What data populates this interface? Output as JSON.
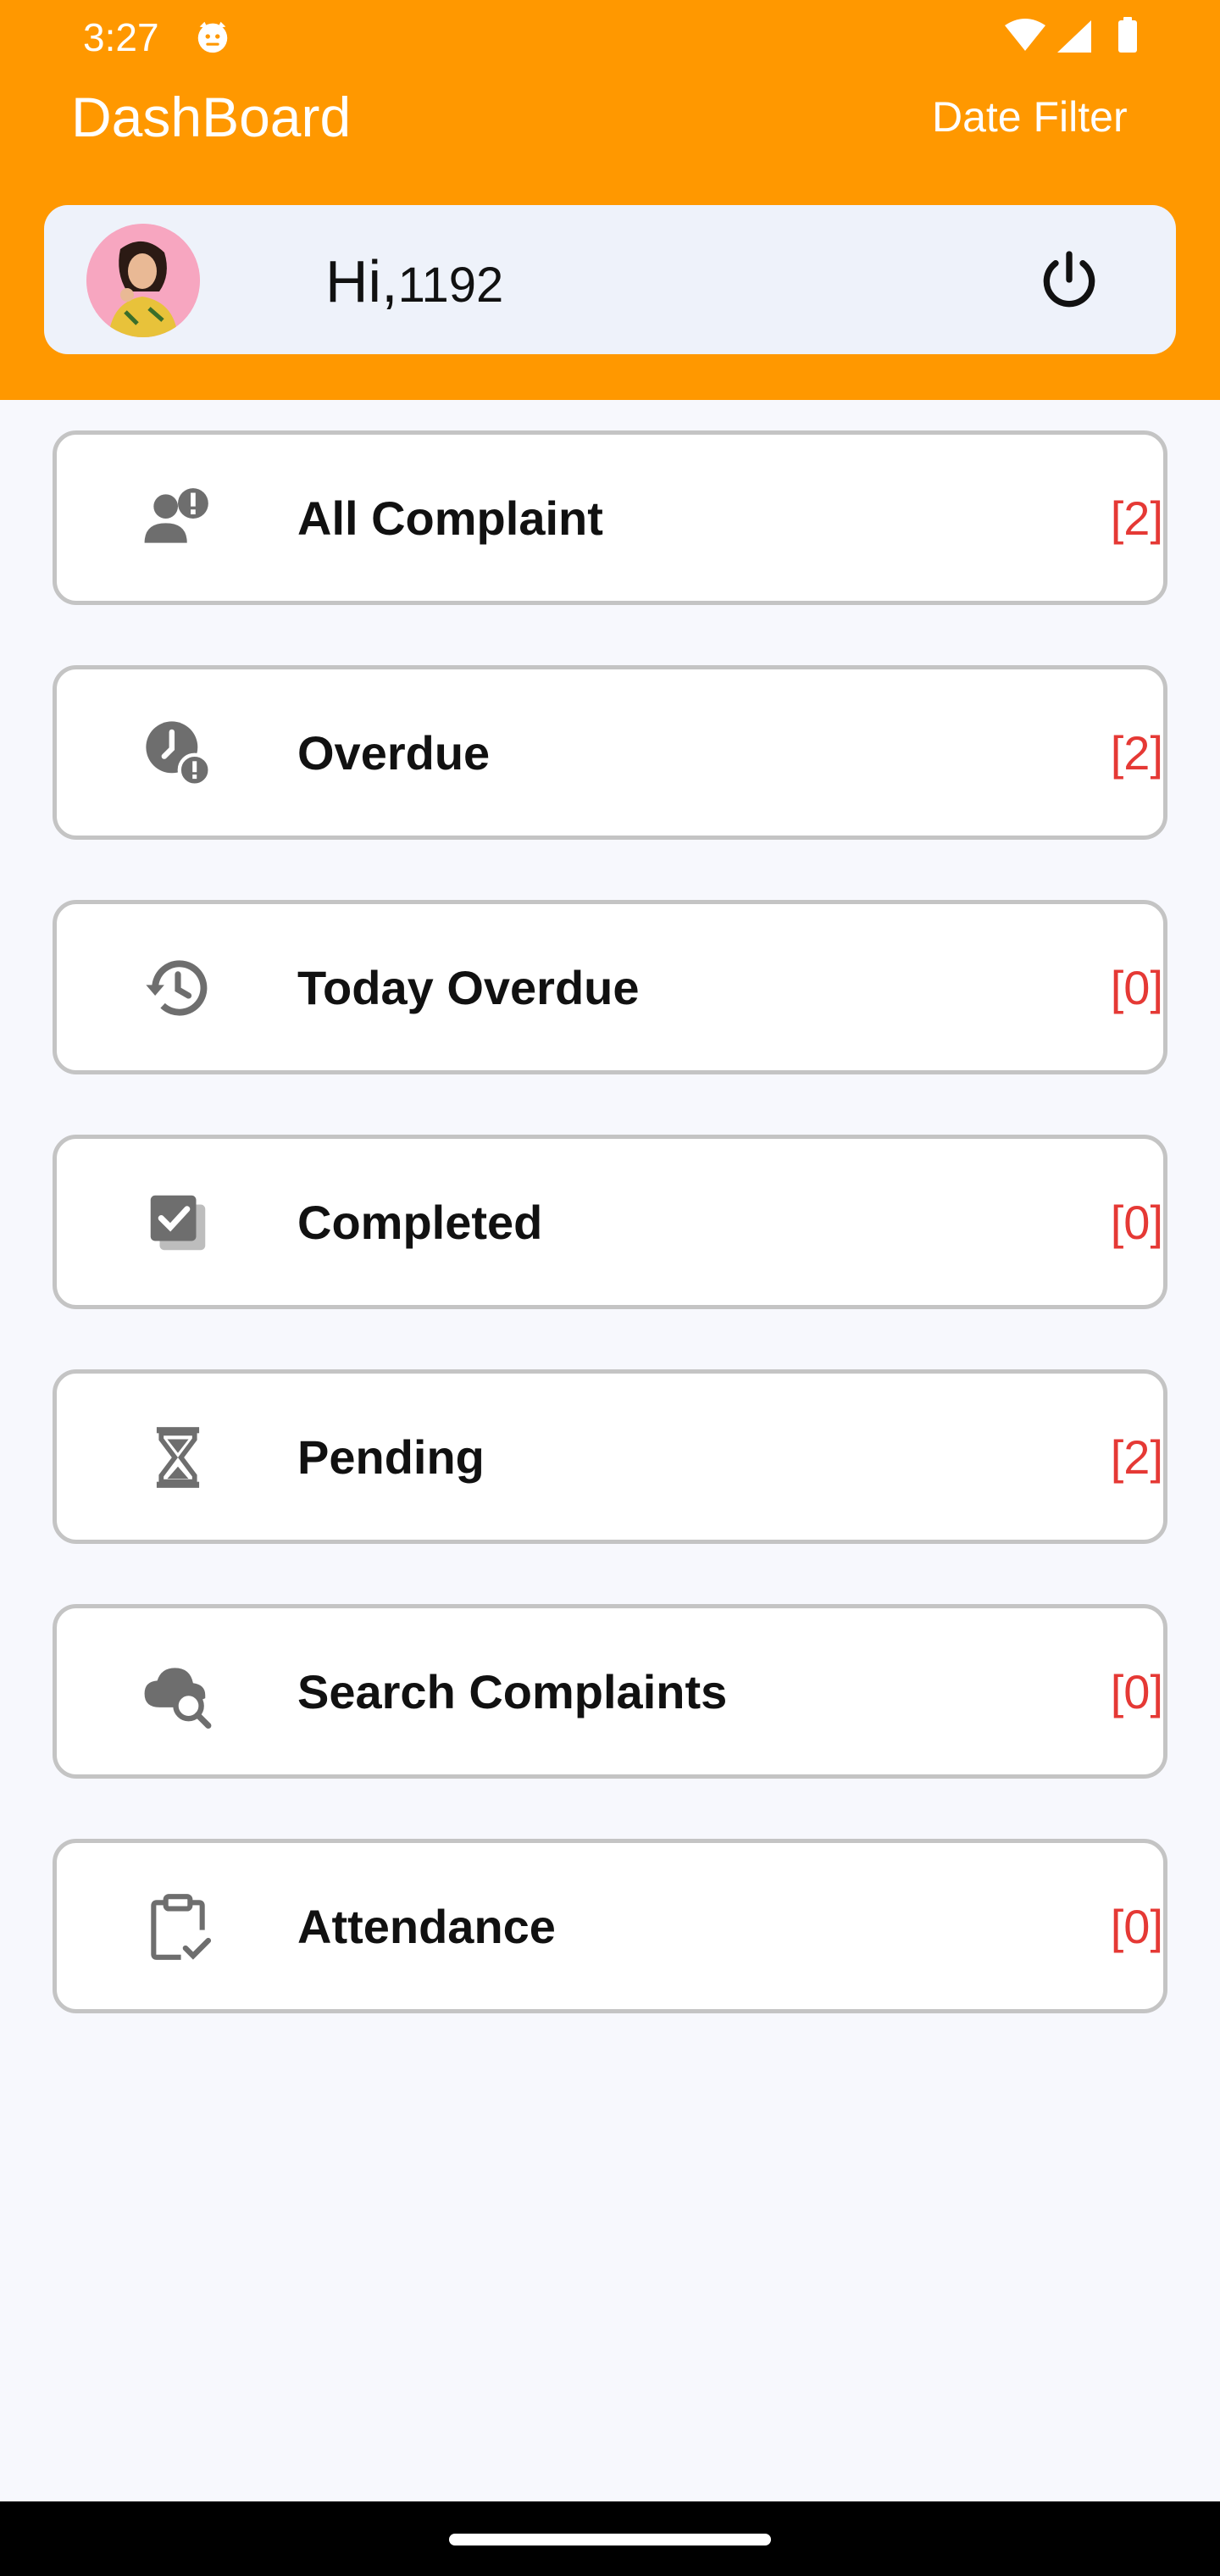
{
  "status_bar": {
    "time": "3:27",
    "notification_icon": "android-cat-icon",
    "icons": [
      "wifi-icon",
      "signal-icon",
      "battery-icon"
    ]
  },
  "app_bar": {
    "title": "DashBoard",
    "date_filter_label": "Date Filter"
  },
  "user": {
    "greeting": "Hi,",
    "user_id": "1192",
    "avatar_icon": "user-avatar",
    "power_icon": "power-icon"
  },
  "menu": {
    "items": [
      {
        "label": "All Complaint",
        "count": "[2]",
        "icon": "report-user-icon"
      },
      {
        "label": "Overdue",
        "count": "[2]",
        "icon": "clock-alert-icon"
      },
      {
        "label": "Today Overdue",
        "count": "[0]",
        "icon": "history-icon"
      },
      {
        "label": "Completed",
        "count": "[0]",
        "icon": "checklist-icon"
      },
      {
        "label": "Pending",
        "count": "[2]",
        "icon": "hourglass-icon"
      },
      {
        "label": "Search Complaints",
        "count": "[0]",
        "icon": "cloud-search-icon"
      },
      {
        "label": "Attendance",
        "count": "[0]",
        "icon": "clipboard-check-icon"
      }
    ]
  },
  "colors": {
    "header": "#ff9800",
    "count": "#e53935",
    "card": "#eef2fa",
    "background": "#f7f8fd",
    "icon": "#6e6e6e"
  }
}
